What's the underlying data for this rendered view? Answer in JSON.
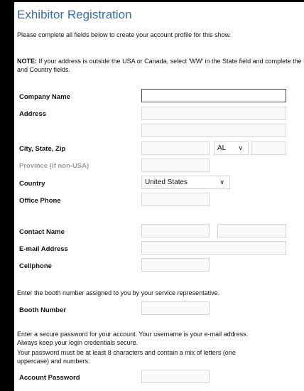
{
  "page": {
    "title": "Exhibitor Registration",
    "intro": "Please complete all fields below to create your account profile for this show.",
    "note_label": "NOTE:",
    "note_text": " If your address is outside the USA or Canada, select 'WW' in the State field and complete the Province and Country fields."
  },
  "labels": {
    "company_name": "Company Name",
    "address": "Address",
    "city_state_zip": "City, State, Zip",
    "province": "Province (if non-USA)",
    "country": "Country",
    "office_phone": "Office Phone",
    "contact_name": "Contact Name",
    "email": "E-mail Address",
    "cellphone": "Cellphone",
    "booth_number": "Booth Number",
    "account_password": "Account Password"
  },
  "fields": {
    "company_name": "",
    "address_line1": "",
    "address_line2": "",
    "city": "",
    "state": "AL",
    "zip": "",
    "province": "",
    "country": "United States",
    "office_phone": "",
    "contact_first": "",
    "contact_last": "",
    "email": "",
    "cellphone": "",
    "booth_number": "",
    "password": ""
  },
  "messages": {
    "booth_instruction": "Enter the booth number assigned to you by your service representative.",
    "password_line1": "Enter a secure password for your account. Your username is your e-mail address.",
    "password_line2": "Always keep your login credentials secure.",
    "password_line3": "Your password must be at least 8 characters and contain a mix of letters (one",
    "password_line4": "uppercase) and numbers."
  },
  "icons": {
    "select_arrow": "chevron-down-icon"
  },
  "colors": {
    "title": "#3a6ea5",
    "focus_border": "#3b4a7a",
    "field_border": "#d6d6d6"
  }
}
